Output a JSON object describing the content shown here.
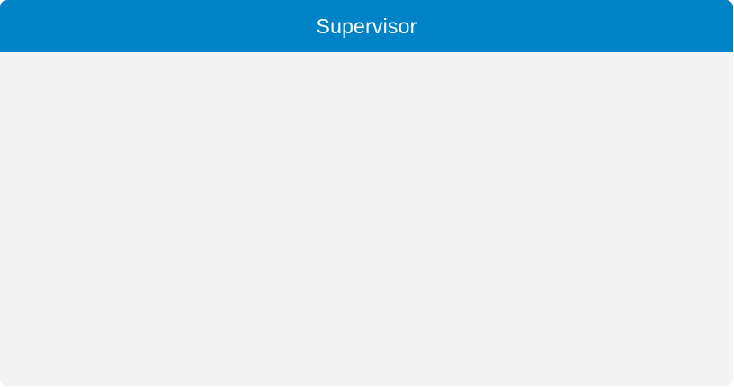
{
  "panel": {
    "title": "Supervisor",
    "colors": {
      "header_background": "#0082c6",
      "header_text": "#ffffff",
      "body_background": "#f4f4f4"
    }
  }
}
